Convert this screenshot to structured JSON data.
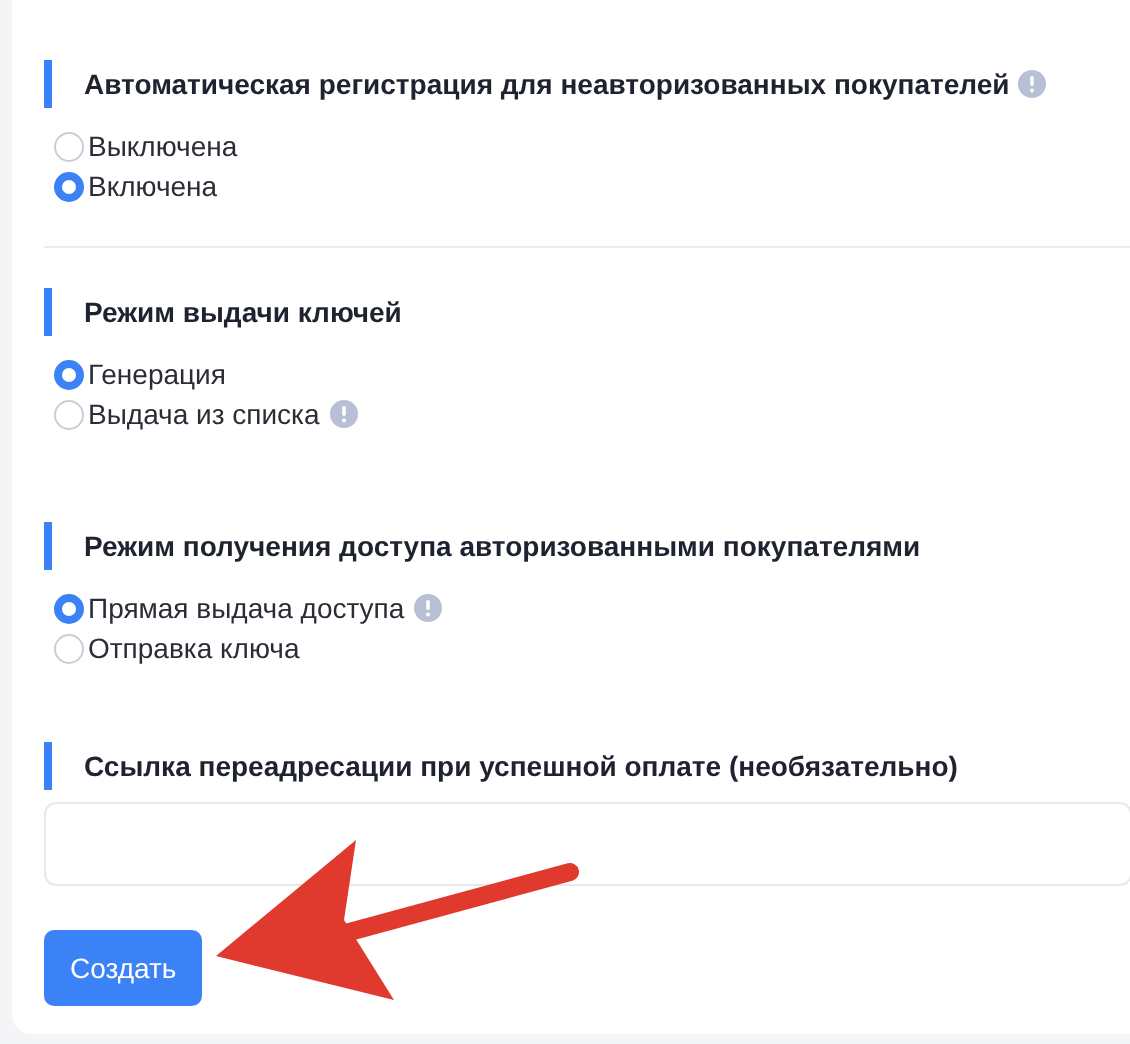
{
  "sections": [
    {
      "kind": "radio",
      "title": "Автоматическая регистрация для неавторизованных покупателей",
      "info": true,
      "divider": true,
      "options": [
        {
          "label": "Выключена",
          "selected": false,
          "info": false
        },
        {
          "label": "Включена",
          "selected": true,
          "info": false
        }
      ]
    },
    {
      "kind": "radio",
      "title": "Режим выдачи ключей",
      "info": false,
      "divider": false,
      "options": [
        {
          "label": "Генерация",
          "selected": true,
          "info": false
        },
        {
          "label": "Выдача из списка",
          "selected": false,
          "info": true
        }
      ]
    },
    {
      "kind": "radio",
      "title": "Режим получения доступа авторизованными покупателями",
      "info": false,
      "divider": false,
      "options": [
        {
          "label": "Прямая выдача доступа",
          "selected": true,
          "info": true
        },
        {
          "label": "Отправка ключа",
          "selected": false,
          "info": false
        }
      ]
    },
    {
      "kind": "input",
      "title": "Ссылка переадресации при успешной оплате (необязательно)",
      "info": false,
      "divider": false
    }
  ],
  "submit_button": "Создать",
  "annotation": {
    "kind": "arrow"
  }
}
